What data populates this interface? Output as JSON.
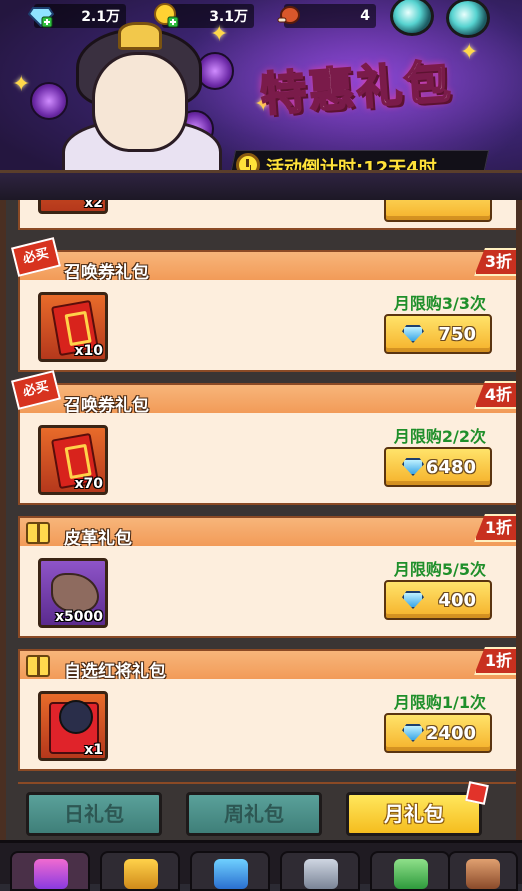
{
  "header": {
    "resources": [
      {
        "name": "diamond",
        "icon": "diamond-plus-icon",
        "value": "2.1万"
      },
      {
        "name": "gold",
        "icon": "gold-coin-plus-icon",
        "value": "3.1万"
      },
      {
        "name": "meat",
        "icon": "meat-icon",
        "value": "4"
      }
    ],
    "title": "特惠礼包",
    "countdown": "活动倒计时:12天4时"
  },
  "packs": [
    {
      "badge": "必买",
      "badge_type": "must-buy",
      "title": "召唤券礼包",
      "discount": "3折",
      "item": "summon-ticket",
      "qty": "x10",
      "limit": "月限购3/3次",
      "price": "750"
    },
    {
      "badge": "必买",
      "badge_type": "must-buy",
      "title": "召唤券礼包",
      "discount": "4折",
      "item": "summon-ticket",
      "qty": "x70",
      "limit": "月限购2/2次",
      "price": "6480"
    },
    {
      "badge": "",
      "badge_type": "gift",
      "title": "皮革礼包",
      "discount": "1折",
      "item": "leather",
      "qty": "x5000",
      "limit": "月限购5/5次",
      "price": "400"
    },
    {
      "badge": "",
      "badge_type": "gift",
      "title": "自选红将礼包",
      "discount": "1折",
      "item": "red-general",
      "qty": "x1",
      "limit": "月限购1/1次",
      "price": "2400"
    }
  ],
  "partial_top_qty": "x2",
  "tabs": {
    "daily": "日礼包",
    "weekly": "周礼包",
    "monthly": "月礼包",
    "selected": "monthly"
  },
  "colors": {
    "limit_green": "#1f8f2a",
    "discount_red": "#c8301f",
    "tab_active": "#f5bd1f",
    "tab_inactive": "#4f928c"
  }
}
